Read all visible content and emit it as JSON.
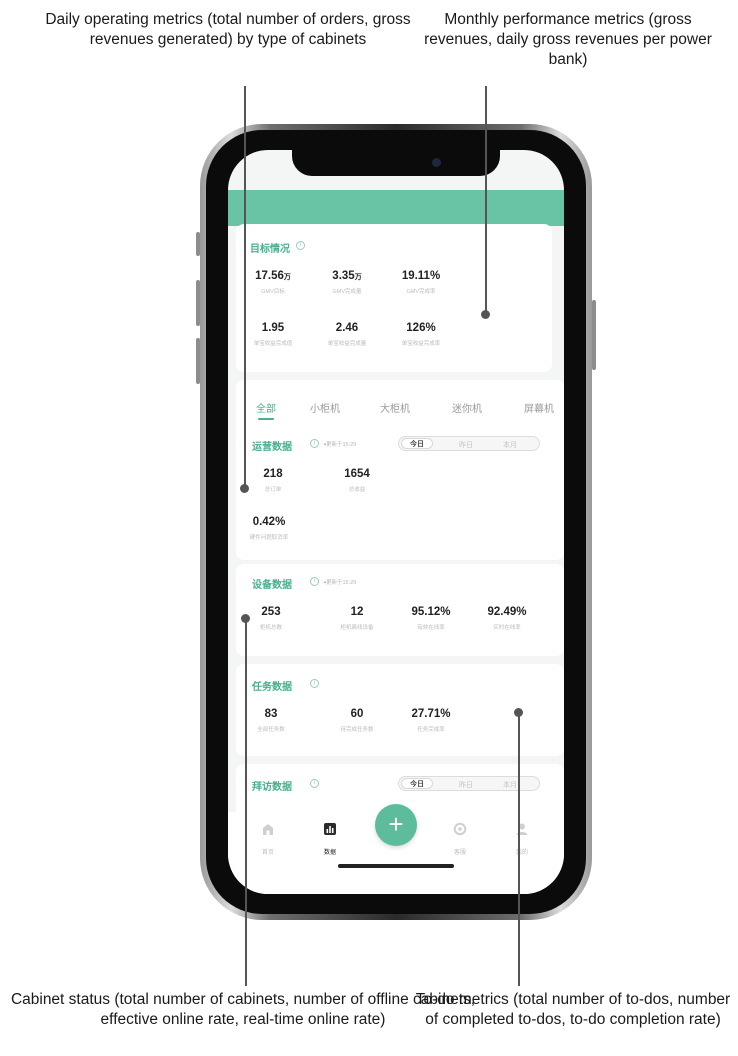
{
  "annotations": {
    "top_left": "Daily operating metrics (total number of orders, gross revenues generated) by type of cabinets",
    "top_right": "Monthly performance metrics (gross revenues, daily gross revenues per power bank)",
    "bottom_left": "Cabinet status (total number of cabinets, number of offline cabinets, effective online rate, real-time online rate)",
    "bottom_right": "To-do metrics (total number of to-dos, number of completed to-dos, to-do completion rate)"
  },
  "colors": {
    "accent": "#48b08f",
    "header": "#69c3a5",
    "fab": "#5cbc9c"
  },
  "target": {
    "title": "目标情况",
    "row1": [
      {
        "value": "17.56",
        "unit": "万",
        "label": "GMV目标"
      },
      {
        "value": "3.35",
        "unit": "万",
        "label": "GMV完成量"
      },
      {
        "value": "19.11%",
        "unit": "",
        "label": "GMV完成率"
      }
    ],
    "row2": [
      {
        "value": "1.95",
        "label": "单宝收益完成值"
      },
      {
        "value": "2.46",
        "label": "单宝收益完成量"
      },
      {
        "value": "126%",
        "label": "单宝收益完成率"
      }
    ]
  },
  "tabs": [
    "全部",
    "小柜机",
    "大柜机",
    "迷你机",
    "屏幕机"
  ],
  "operations": {
    "title": "运营数据",
    "updated": "更新于15:29",
    "segments": [
      "今日",
      "昨日",
      "本月"
    ],
    "metrics": [
      {
        "value": "218",
        "label": "总订单"
      },
      {
        "value": "1654",
        "label": "总收益"
      },
      {
        "value": "0.42%",
        "label": "硬件问题取消率"
      }
    ]
  },
  "devices": {
    "title": "设备数据",
    "updated": "更新于15:29",
    "metrics": [
      {
        "value": "253",
        "label": "柜机总数"
      },
      {
        "value": "12",
        "label": "柜机离线设备"
      },
      {
        "value": "95.12%",
        "label": "有效在线率"
      },
      {
        "value": "92.49%",
        "label": "实时在线率"
      }
    ]
  },
  "tasks": {
    "title": "任务数据",
    "metrics": [
      {
        "value": "83",
        "label": "全部任务数"
      },
      {
        "value": "60",
        "label": "待完成任务数"
      },
      {
        "value": "27.71%",
        "label": "任务完成率"
      }
    ]
  },
  "visits": {
    "title": "拜访数据",
    "segments": [
      "今日",
      "昨日",
      "本月"
    ]
  },
  "nav": {
    "items": [
      {
        "label": "首页",
        "icon": "home-icon"
      },
      {
        "label": "数据",
        "icon": "chart-icon"
      },
      {
        "label": "客服",
        "icon": "service-icon"
      },
      {
        "label": "我的",
        "icon": "user-icon"
      }
    ],
    "fab": "+"
  }
}
